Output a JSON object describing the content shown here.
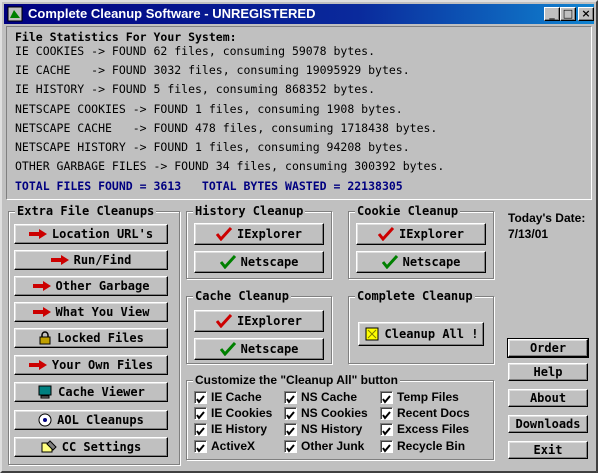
{
  "window": {
    "title": "Complete Cleanup Software - UNREGISTERED"
  },
  "stats": {
    "heading": "File Statistics For Your System:",
    "lines": [
      "IE COOKIES -> FOUND 62 files, consuming 59078 bytes.",
      "IE CACHE   -> FOUND 3032 files, consuming 19095929 bytes.",
      "IE HISTORY -> FOUND 5 files, consuming 868352 bytes.",
      "NETSCAPE COOKIES -> FOUND 1 files, consuming 1908 bytes.",
      "NETSCAPE CACHE   -> FOUND 478 files, consuming 1718438 bytes.",
      "NETSCAPE HISTORY -> FOUND 1 files, consuming 94208 bytes.",
      "OTHER GARBAGE FILES -> FOUND 34 files, consuming 300392 bytes."
    ],
    "total": "TOTAL FILES FOUND = 3613   TOTAL BYTES WASTED = 22138305",
    "total_color": "#000080"
  },
  "extra": {
    "title": "Extra File Cleanups",
    "buttons": [
      "Location URL's",
      "Run/Find",
      "Other Garbage",
      "What You View",
      "Locked Files",
      "Your Own Files",
      "Cache Viewer",
      "AOL Cleanups",
      "CC Settings"
    ]
  },
  "history": {
    "title": "History Cleanup",
    "ie": "IExplorer",
    "ns": "Netscape"
  },
  "cookie": {
    "title": "Cookie Cleanup",
    "ie": "IExplorer",
    "ns": "Netscape"
  },
  "cache": {
    "title": "Cache Cleanup",
    "ie": "IExplorer",
    "ns": "Netscape"
  },
  "complete": {
    "title": "Complete Cleanup",
    "button": "Cleanup All !"
  },
  "date": {
    "label": "Today's Date:",
    "value": "7/13/01"
  },
  "right_buttons": {
    "order": "Order",
    "help": "Help",
    "about": "About",
    "downloads": "Downloads",
    "exit": "Exit"
  },
  "customize": {
    "title": "Customize the \"Cleanup All\" button",
    "items": [
      [
        "IE Cache",
        "NS Cache",
        "Temp Files"
      ],
      [
        "IE Cookies",
        "NS Cookies",
        "Recent Docs"
      ],
      [
        "IE History",
        "NS History",
        "Excess Files"
      ],
      [
        "ActiveX",
        "Other Junk",
        "Recycle Bin"
      ]
    ],
    "all_checked": true
  },
  "colors": {
    "titlebar": "#000080",
    "arrow": "#cc0000",
    "check_red": "#cc0000",
    "check_green": "#008000"
  }
}
